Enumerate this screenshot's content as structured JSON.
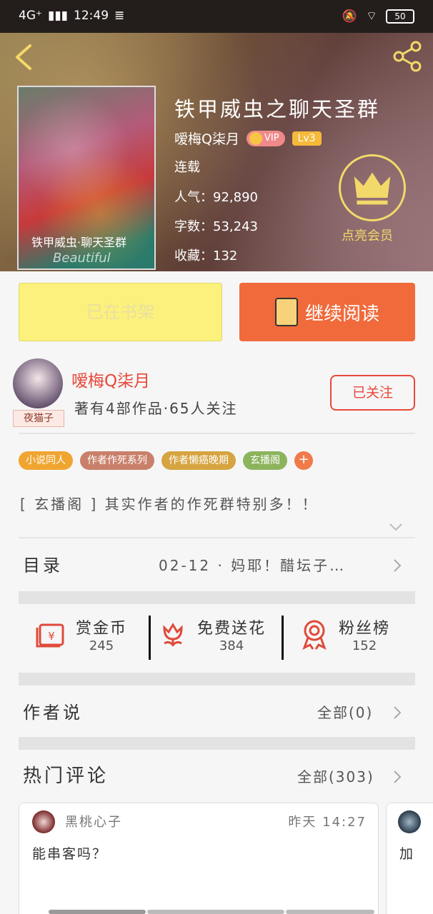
{
  "status_bar": {
    "network": "4G⁺",
    "time": "12:49",
    "battery": "50"
  },
  "book": {
    "title": "铁甲威虫之聊天圣群",
    "author": "嗳梅Q柒月",
    "vip_label": "VIP",
    "level": "Lv3",
    "state": "连载",
    "popularity": "人气：92,890",
    "word_count": "字数：53,243",
    "favorites": "收藏：132",
    "cover_caption": "铁甲威虫·聊天圣群",
    "cover_caption2": "Beautiful"
  },
  "member": {
    "label": "点亮会员"
  },
  "actions": {
    "shelf_label": "已在书架",
    "read_label": "继续阅读"
  },
  "author_card": {
    "avatar_tag": "夜猫子",
    "name": "嗳梅Q柒月",
    "stats": "著有4部作品·65人关注",
    "follow_label": "已关注"
  },
  "tags": [
    {
      "label": "小说同人",
      "color": "#f0a531"
    },
    {
      "label": "作者作死系列",
      "color": "#c9806a"
    },
    {
      "label": "作者懒癌晚期",
      "color": "#d6a440"
    },
    {
      "label": "玄播阁",
      "color": "#8cb45c"
    }
  ],
  "tag_plus": "+",
  "description": "[ 玄播阁 ] 其实作者的作死群特别多！！",
  "catalog": {
    "label": "目录",
    "latest": "02-12 · 妈耶！醋坛子…"
  },
  "stats": [
    {
      "label": "赏金币",
      "value": "245",
      "icon": "red-envelope-icon",
      "color": "#e04a3a"
    },
    {
      "label": "免费送花",
      "value": "384",
      "icon": "flower-icon",
      "color": "#e04a3a"
    },
    {
      "label": "粉丝榜",
      "value": "152",
      "icon": "ribbon-medal-icon",
      "color": "#e04a3a"
    }
  ],
  "author_says": {
    "label": "作者说",
    "all": "全部(0)"
  },
  "hot_comments": {
    "label": "热门评论",
    "all": "全部(303)"
  },
  "comments": [
    {
      "user": "黑桃心子",
      "time": "昨天 14:27",
      "text": "能串客吗？"
    },
    {
      "user": "",
      "time": "",
      "text": "加"
    }
  ],
  "colors": {
    "accent": "#f06a3c",
    "author_red": "#e8473a",
    "shelf_yellow": "#fbf17c",
    "gold": "#f2d96a"
  }
}
